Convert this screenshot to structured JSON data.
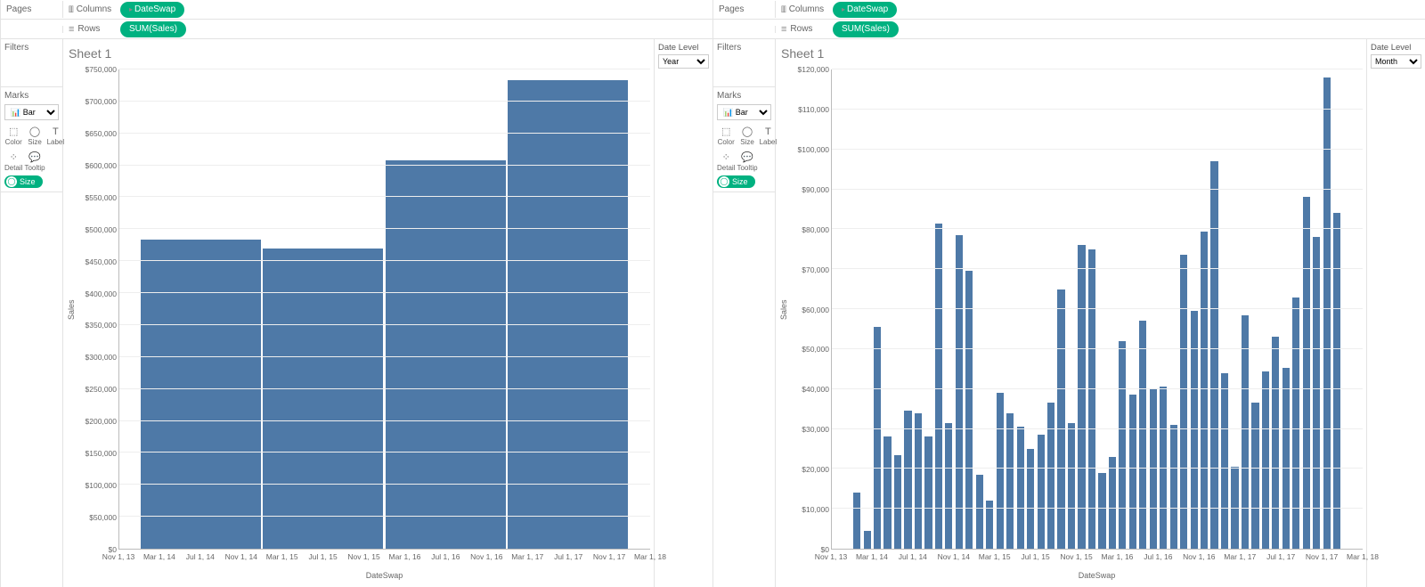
{
  "sides": {
    "pages": "Pages",
    "filters": "Filters",
    "marks": "Marks",
    "columns": "Columns",
    "rows": "Rows"
  },
  "pills": {
    "columns": "DateSwap",
    "rows": "SUM(Sales)"
  },
  "marks": {
    "type_label": "Bar",
    "color": "Color",
    "size": "Size",
    "label": "Label",
    "detail": "Detail",
    "tooltip": "Tooltip",
    "size_pill": "Size"
  },
  "sheet_title": "Sheet 1",
  "date_level_label": "Date Level",
  "left_param_value": "Year",
  "right_param_value": "Month",
  "left_chart": {
    "y_label": "Sales",
    "x_label": "DateSwap",
    "y_ticks": [
      "$0",
      "$50,000",
      "$100,000",
      "$150,000",
      "$200,000",
      "$250,000",
      "$300,000",
      "$350,000",
      "$400,000",
      "$450,000",
      "$500,000",
      "$550,000",
      "$600,000",
      "$650,000",
      "$700,000",
      "$750,000"
    ],
    "x_ticks": [
      "Nov 1, 13",
      "Mar 1, 14",
      "Jul 1, 14",
      "Nov 1, 14",
      "Mar 1, 15",
      "Jul 1, 15",
      "Nov 1, 15",
      "Mar 1, 16",
      "Jul 1, 16",
      "Nov 1, 16",
      "Mar 1, 17",
      "Jul 1, 17",
      "Nov 1, 17",
      "Mar 1, 18"
    ]
  },
  "right_chart": {
    "y_label": "Sales",
    "x_label": "DateSwap",
    "y_ticks": [
      "$0",
      "$10,000",
      "$20,000",
      "$30,000",
      "$40,000",
      "$50,000",
      "$60,000",
      "$70,000",
      "$80,000",
      "$90,000",
      "$100,000",
      "$110,000",
      "$120,000"
    ],
    "x_ticks": [
      "Nov 1, 13",
      "Mar 1, 14",
      "Jul 1, 14",
      "Nov 1, 14",
      "Mar 1, 15",
      "Jul 1, 15",
      "Nov 1, 15",
      "Mar 1, 16",
      "Jul 1, 16",
      "Nov 1, 16",
      "Mar 1, 17",
      "Jul 1, 17",
      "Nov 1, 17",
      "Mar 1, 18"
    ]
  },
  "chart_data": [
    {
      "type": "bar",
      "title": "Sheet 1",
      "xlabel": "DateSwap",
      "ylabel": "Sales",
      "ylim": [
        0,
        750000
      ],
      "categories": [
        "2014",
        "2015",
        "2016",
        "2017"
      ],
      "values": [
        484000,
        470000,
        608000,
        733000
      ]
    },
    {
      "type": "bar",
      "title": "Sheet 1",
      "xlabel": "DateSwap",
      "ylabel": "Sales",
      "ylim": [
        0,
        120000
      ],
      "categories": [
        "Jan 14",
        "Feb 14",
        "Mar 14",
        "Apr 14",
        "May 14",
        "Jun 14",
        "Jul 14",
        "Aug 14",
        "Sep 14",
        "Oct 14",
        "Nov 14",
        "Dec 14",
        "Jan 15",
        "Feb 15",
        "Mar 15",
        "Apr 15",
        "May 15",
        "Jun 15",
        "Jul 15",
        "Aug 15",
        "Sep 15",
        "Oct 15",
        "Nov 15",
        "Dec 15",
        "Jan 16",
        "Feb 16",
        "Mar 16",
        "Apr 16",
        "May 16",
        "Jun 16",
        "Jul 16",
        "Aug 16",
        "Sep 16",
        "Oct 16",
        "Nov 16",
        "Dec 16",
        "Jan 17",
        "Feb 17",
        "Mar 17",
        "Apr 17",
        "May 17",
        "Jun 17",
        "Jul 17",
        "Aug 17",
        "Sep 17",
        "Oct 17",
        "Nov 17",
        "Dec 17"
      ],
      "values": [
        14000,
        4500,
        55500,
        28000,
        23500,
        34500,
        34000,
        28000,
        81500,
        31500,
        78500,
        69500,
        18500,
        12000,
        39000,
        34000,
        30500,
        25000,
        28500,
        36500,
        65000,
        31500,
        76000,
        75000,
        19000,
        23000,
        52000,
        38500,
        57000,
        40000,
        40500,
        31000,
        73500,
        59500,
        79500,
        97000,
        44000,
        20500,
        58500,
        36500,
        44500,
        53000,
        45200,
        63000,
        88000,
        78000,
        118000,
        84000
      ]
    }
  ]
}
